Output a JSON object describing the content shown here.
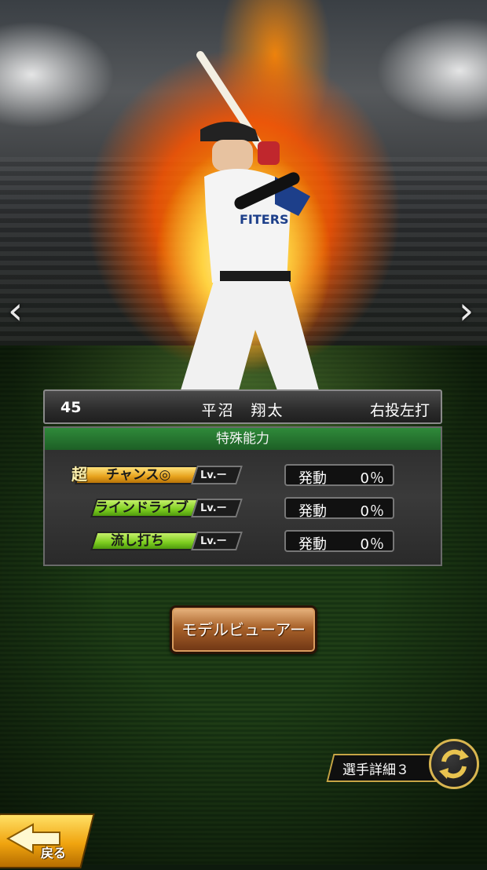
{
  "player": {
    "number": "45",
    "name": "平沼　翔太",
    "handedness": "右投左打"
  },
  "abilities_panel": {
    "title": "特殊能力",
    "abilities": [
      {
        "prefix": "超",
        "name": "チャンス◎",
        "level": "Lv.ー",
        "activation_label": "発動",
        "activation_pct": "0％",
        "color": "#e7a21c"
      },
      {
        "prefix": "",
        "name": "ラインドライブ",
        "level": "Lv.ー",
        "activation_label": "発動",
        "activation_pct": "0％",
        "color": "#7ccc1f"
      },
      {
        "prefix": "",
        "name": "流し打ち",
        "level": "Lv.ー",
        "activation_label": "発動",
        "activation_pct": "0％",
        "color": "#7ccc1f"
      }
    ]
  },
  "buttons": {
    "model_viewer": "モデルビューアー",
    "player_detail": "選手詳細３",
    "back": "戻る"
  },
  "icons": {
    "prev": "chevron-left-icon",
    "next": "chevron-right-icon",
    "cycle": "cycle-arrows-icon",
    "back": "back-arrow-icon"
  },
  "colors": {
    "panel_header": "#1d5f25",
    "accent_gold": "#d8b550"
  }
}
